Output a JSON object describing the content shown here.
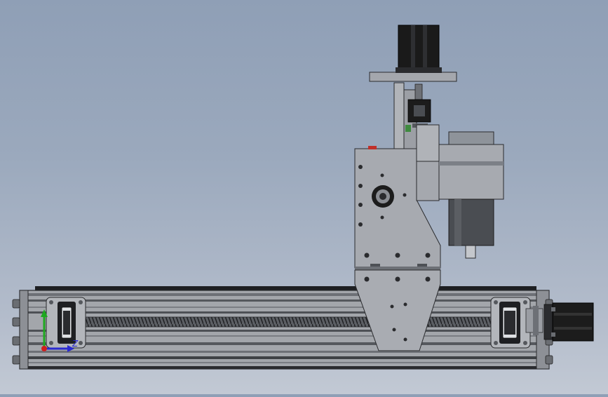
{
  "viewport": {
    "background_top": "#8f9fb6",
    "background_bottom": "#c2c9d4"
  },
  "triad": {
    "z_axis_label": "Z",
    "x_axis_color": "#2a2ad0",
    "y_axis_color": "#1fa81f",
    "origin_color": "#d01f1f"
  },
  "colors": {
    "steel": "#a4a7ad",
    "dark_steel": "#7c8087",
    "motor_black": "#1c1c1c",
    "spindle_body": "#8e939a",
    "spindle_dark": "#4a4d52",
    "red_marker": "#c0302a",
    "green_marker": "#3f8a3f"
  }
}
